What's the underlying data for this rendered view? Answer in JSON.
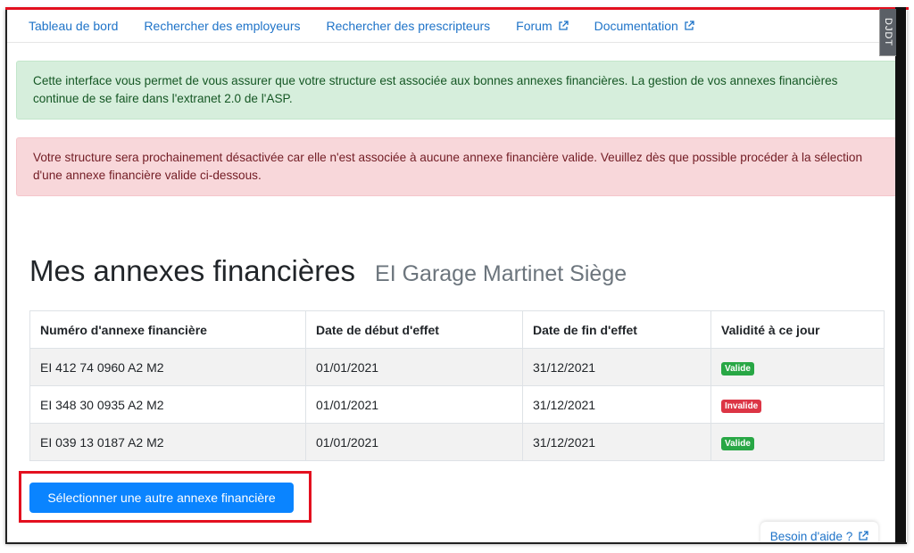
{
  "nav": {
    "items": [
      {
        "label": "Tableau de bord",
        "external": false
      },
      {
        "label": "Rechercher des employeurs",
        "external": false
      },
      {
        "label": "Rechercher des prescripteurs",
        "external": false
      },
      {
        "label": "Forum",
        "external": true
      },
      {
        "label": "Documentation",
        "external": true
      }
    ],
    "side_tab": "DJDT"
  },
  "alerts": {
    "info": "Cette interface vous permet de vous assurer que votre structure est associée aux bonnes annexes financières. La gestion de vos annexes financières continue de se faire dans l'extranet 2.0 de l'ASP.",
    "danger": "Votre structure sera prochainement désactivée car elle n'est associée à aucune annexe financière valide. Veuillez dès que possible procéder à la sélection d'une annexe financière valide ci-dessous."
  },
  "page": {
    "title": "Mes annexes financières",
    "organization": "EI Garage Martinet Siège"
  },
  "table": {
    "headers": [
      "Numéro d'annexe financière",
      "Date de début d'effet",
      "Date de fin d'effet",
      "Validité à ce jour"
    ],
    "rows": [
      {
        "numero": "EI 412 74 0960 A2 M2",
        "debut": "01/01/2021",
        "fin": "31/12/2021",
        "validite": "Valide",
        "status": "valid"
      },
      {
        "numero": "EI 348 30 0935 A2 M2",
        "debut": "01/01/2021",
        "fin": "31/12/2021",
        "validite": "Invalide",
        "status": "invalid"
      },
      {
        "numero": "EI 039 13 0187 A2 M2",
        "debut": "01/01/2021",
        "fin": "31/12/2021",
        "validite": "Valide",
        "status": "valid"
      }
    ]
  },
  "actions": {
    "select_other": "Sélectionner une autre annexe financière"
  },
  "help": {
    "label": "Besoin d'aide ?"
  },
  "colors": {
    "link": "#1e73c8",
    "primary": "#0a84ff",
    "success": "#28a745",
    "danger": "#dc3545",
    "highlight": "#e3101f"
  }
}
